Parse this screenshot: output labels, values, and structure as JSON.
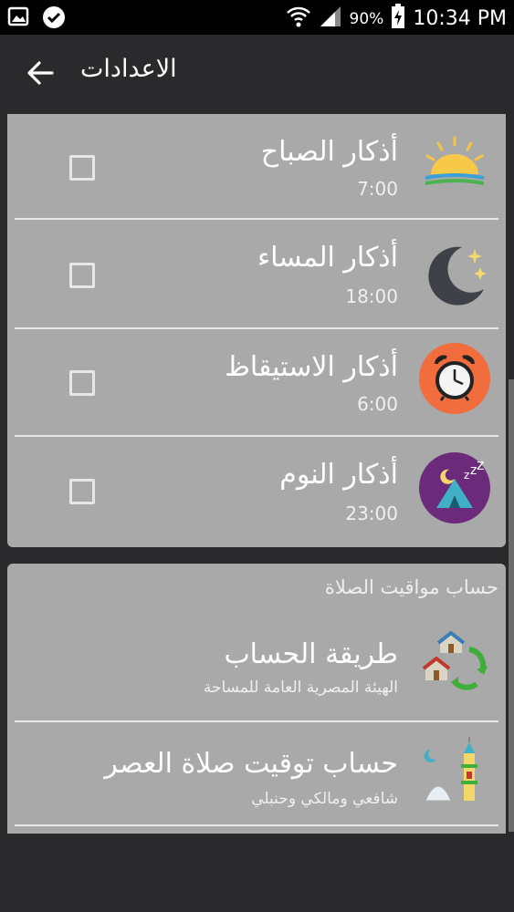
{
  "status_bar": {
    "battery_percent": "90%",
    "time": "10:34 PM",
    "icons": [
      "gallery-icon",
      "check-circle-icon",
      "wifi-icon",
      "signal-icon",
      "battery-charging-icon"
    ]
  },
  "toolbar": {
    "title": "الاعدادات",
    "back_icon": "arrow-back-icon"
  },
  "reminders": [
    {
      "title": "أذكار الصباح",
      "time": "7:00",
      "icon": "sunrise-icon",
      "checked": false
    },
    {
      "title": "أذكار المساء",
      "time": "18:00",
      "icon": "moon-stars-icon",
      "checked": false
    },
    {
      "title": "أذكار الاستيقاظ",
      "time": "6:00",
      "icon": "alarm-clock-icon",
      "checked": false
    },
    {
      "title": "أذكار النوم",
      "time": "23:00",
      "icon": "sleep-tent-icon",
      "checked": false
    }
  ],
  "prayer_section": {
    "header": "حساب مواقيت الصلاة",
    "items": [
      {
        "title": "طريقة الحساب",
        "subtitle": "الهيئة المصرية العامة للمساحة",
        "icon": "houses-sync-icon"
      },
      {
        "title": "حساب توقيت صلاة العصر",
        "subtitle": "شافعي ومالكي وحنبلي",
        "icon": "mosque-minaret-icon"
      }
    ]
  },
  "colors": {
    "background": "#2a2a2c",
    "card": "#a9a9a9",
    "divider": "#e8e8e8",
    "text": "#ffffff"
  }
}
